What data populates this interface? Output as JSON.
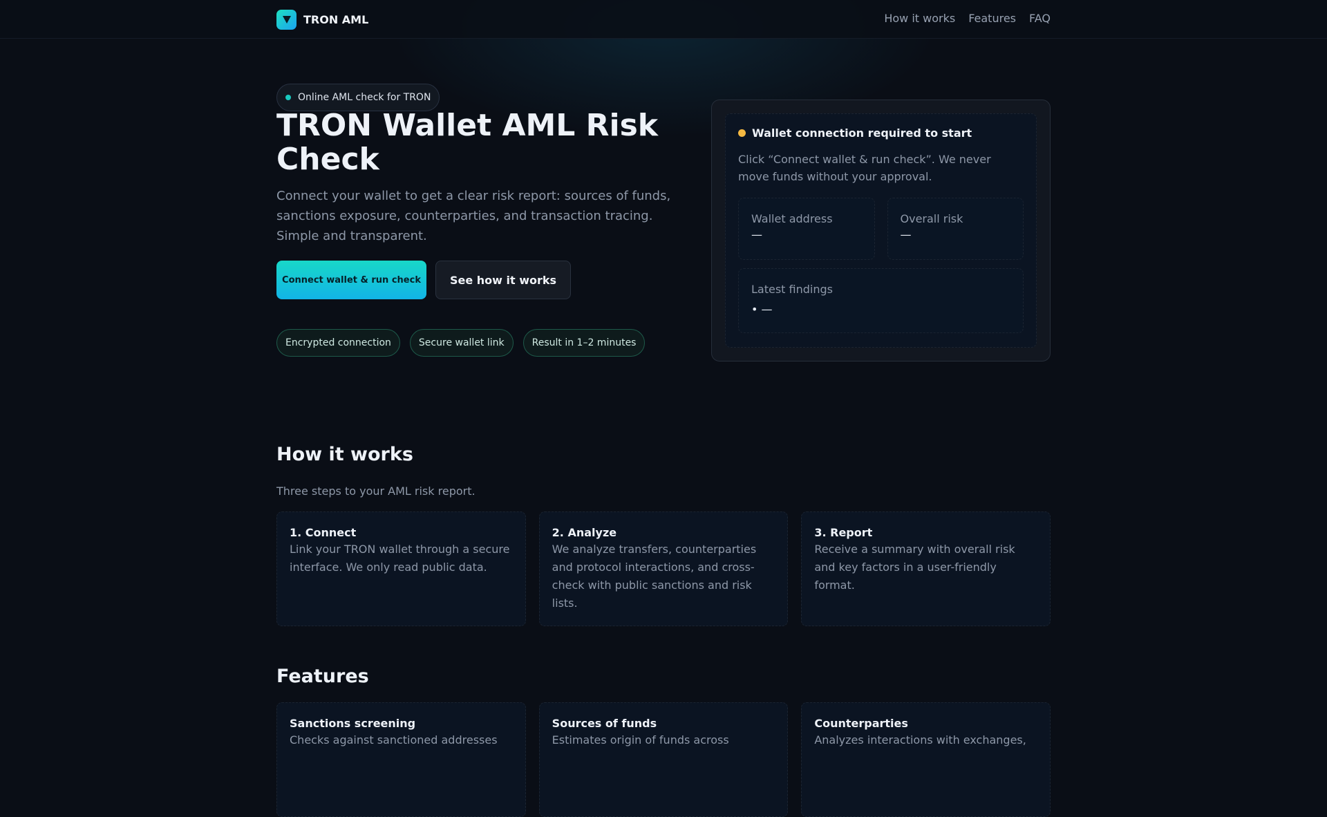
{
  "header": {
    "brand": "TRON AML",
    "logo_icon": "tron-triangle-icon",
    "nav": [
      "How it works",
      "Features",
      "FAQ"
    ]
  },
  "hero": {
    "pill": "Online AML check for TRON",
    "title": "TRON Wallet AML Risk Check",
    "lead": "Connect your wallet to get a clear risk report: sources of funds, sanctions exposure, counterparties, and transaction tracing. Simple and transparent.",
    "primary_cta": "Connect wallet & run check",
    "secondary_cta": "See how it works",
    "badges": [
      "Encrypted connection",
      "Secure wallet link",
      "Result in 1–2 minutes"
    ]
  },
  "panel": {
    "status": "Wallet connection required to start",
    "note": "Click “Connect wallet & run check”. We never move funds without your approval.",
    "wallet_label": "Wallet address",
    "wallet_value": "—",
    "risk_label": "Overall risk",
    "risk_value": "—",
    "findings_label": "Latest findings",
    "findings": [
      "—"
    ]
  },
  "how": {
    "title": "How it works",
    "subtitle": "Three steps to your AML risk report.",
    "steps": [
      {
        "title": "1. Connect",
        "text": "Link your TRON wallet through a secure interface. We only read public data."
      },
      {
        "title": "2. Analyze",
        "text": "We analyze transfers, counterparties and protocol interactions, and cross-check with public sanctions and risk lists."
      },
      {
        "title": "3. Report",
        "text": "Receive a summary with overall risk and key factors in a user-friendly format."
      }
    ]
  },
  "features": {
    "title": "Features",
    "items": [
      {
        "title": "Sanctions screening",
        "text": "Checks against sanctioned addresses"
      },
      {
        "title": "Sources of funds",
        "text": "Estimates origin of funds across"
      },
      {
        "title": "Counterparties",
        "text": "Analyzes interactions with exchanges,"
      }
    ]
  },
  "colors": {
    "accent": "#18d8c8",
    "accent_alt": "#12b4e6",
    "warning_dot": "#f5b942",
    "background": "#0a0e16"
  }
}
